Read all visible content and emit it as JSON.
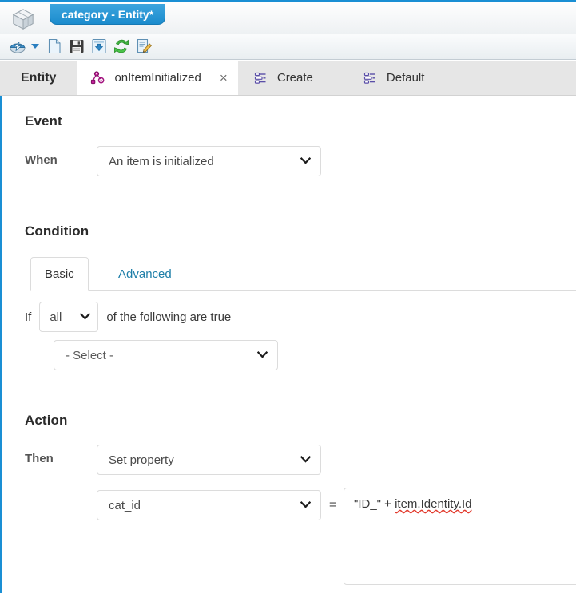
{
  "window": {
    "app_icon": "cube-icon",
    "document_tab_title": "category - Entity*"
  },
  "toolbar": {
    "items": [
      {
        "name": "navigate-icon",
        "tooltip": "Navigate"
      },
      {
        "name": "dropdown-caret-icon",
        "tooltip": "More"
      },
      {
        "name": "new-document-icon",
        "tooltip": "New"
      },
      {
        "name": "save-icon",
        "tooltip": "Save"
      },
      {
        "name": "import-icon",
        "tooltip": "Import"
      },
      {
        "name": "refresh-icon",
        "tooltip": "Refresh"
      },
      {
        "name": "edit-icon",
        "tooltip": "Edit"
      }
    ]
  },
  "tabs": [
    {
      "label": "Entity",
      "icon": null,
      "active": false,
      "closable": false
    },
    {
      "label": "onItemInitialized",
      "icon": "rule-graph-icon",
      "active": true,
      "closable": true
    },
    {
      "label": "Create",
      "icon": "list-form-icon",
      "active": false,
      "closable": false
    },
    {
      "label": "Default",
      "icon": "list-form-icon",
      "active": false,
      "closable": false
    }
  ],
  "tab_close_glyph": "×",
  "event": {
    "section_title": "Event",
    "when_label": "When",
    "when_value": "An item is initialized"
  },
  "condition": {
    "section_title": "Condition",
    "tabs": [
      {
        "label": "Basic",
        "active": true
      },
      {
        "label": "Advanced",
        "active": false
      }
    ],
    "if_prefix": "If",
    "quantifier_value": "all",
    "if_suffix": "of the following are true",
    "rule_select_value": "- Select -"
  },
  "action": {
    "section_title": "Action",
    "then_label": "Then",
    "then_value": "Set property",
    "property_value": "cat_id",
    "equals_sign": "=",
    "expression_prefix": "\"ID_\" + ",
    "expression_misspelled": "item.Identity.Id"
  },
  "colors": {
    "accent_blue": "#1a8fd4",
    "tab_link": "#1d7ea8",
    "tabbar_bg": "#e6e6e6",
    "spellcheck_red": "#e23b2e",
    "rule_icon_magenta": "#a3147f"
  }
}
